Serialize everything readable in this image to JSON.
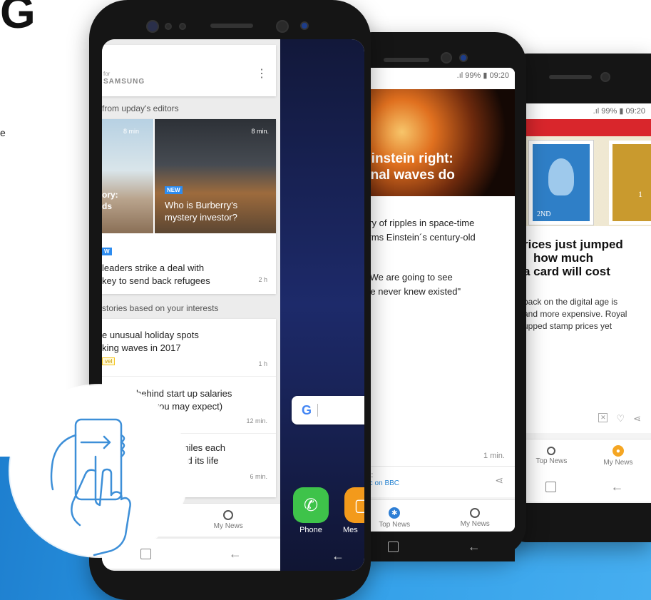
{
  "page": {
    "corner_glyph": "G",
    "side_text": "e"
  },
  "phone_front": {
    "brand_for": "for",
    "brand_name": "SAMSUNG",
    "menu_icon": "more-vert-icon",
    "section1_title": "from upday's editors",
    "tile_left": {
      "time": "8 min",
      "headline_line1": "ory:",
      "headline_line2": "ds"
    },
    "tile_right": {
      "time": "8 min.",
      "badge": "NEW",
      "headline_line1": "Who is Burberry's",
      "headline_line2": "mystery investor?"
    },
    "article1": {
      "badge": "W",
      "line1": "leaders strike a deal with",
      "line2": "key to send back refugees",
      "time": "2 h"
    },
    "section2_title": "stories based on your interests",
    "article2": {
      "line1": "e unusual holiday spots",
      "line2": "king waves in 2017",
      "tag": "vel",
      "time": "1 h"
    },
    "article3": {
      "line1": "behind start up salaries",
      "line2": "hat you may expect)",
      "time": "12 min."
    },
    "article4": {
      "line1": "0 miles each",
      "line2": "saved its life",
      "time": "6 min."
    },
    "nav_my_news": "My News",
    "search_g": "G",
    "app_phone": "Phone",
    "app_messages": "Mes"
  },
  "phone_middle": {
    "status": ".ıl 99% ▮ 09:20",
    "hero_line1": "Einstein right:",
    "hero_line2": "onal waves do",
    "body_line1": "ery of ripples in space-time",
    "body_line2": "firms Einstein´s century-old",
    "quote_line1": "\"We are going to see",
    "quote_line2": "we never knew existed\"",
    "read_time": "1 min.",
    "source_label": "ds:",
    "source_link": "pic on BBC",
    "nav_top_news": "Top News",
    "nav_my_news": "My News"
  },
  "phone_back": {
    "status": ".ıl 99% ▮ 09:20",
    "stamp_label1": "2ND",
    "stamp_label2": "1",
    "headline_line1": "rices just jumped",
    "headline_line2": "how much",
    "headline_line3": "a card will cost",
    "body_line1": "back on the digital age is",
    "body_line2": "and more expensive. Royal",
    "body_line3": "upped stamp prices yet",
    "nav_top_news": "Top News",
    "nav_my_news": "My News"
  },
  "colors": {
    "accent_blue": "#1e7fcf",
    "badge_blue": "#2d8cf0",
    "top_news_blue": "#2e7fd6",
    "my_news_orange": "#f5a623",
    "phone_green": "#3ec34a",
    "messages_orange": "#f39a1b",
    "link_blue": "#2a86d4"
  }
}
